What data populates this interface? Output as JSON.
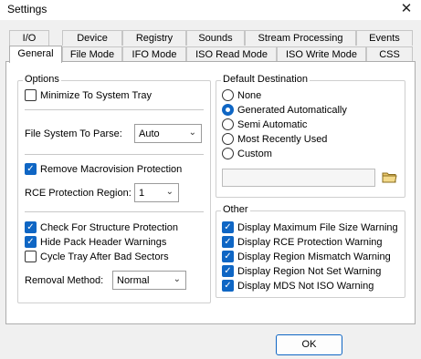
{
  "window": {
    "title": "Settings",
    "close_glyph": "✕"
  },
  "tabs_row1": [
    "I/O",
    "Device",
    "Registry",
    "Sounds",
    "Stream Processing",
    "Events"
  ],
  "tabs_row2": [
    "General",
    "File Mode",
    "IFO Mode",
    "ISO Read Mode",
    "ISO Write Mode",
    "CSS"
  ],
  "active_tab": "General",
  "options": {
    "title": "Options",
    "minimize_to_tray": {
      "label": "Minimize To System Tray",
      "checked": false
    },
    "fs_label": "File System To Parse:",
    "fs_value": "Auto",
    "remove_macrovision": {
      "label": "Remove Macrovision Protection",
      "checked": true
    },
    "rce_label": "RCE Protection Region:",
    "rce_value": "1",
    "check_structure": {
      "label": "Check For Structure Protection",
      "checked": true
    },
    "hide_pack_header": {
      "label": "Hide Pack Header Warnings",
      "checked": true
    },
    "cycle_tray": {
      "label": "Cycle Tray After Bad Sectors",
      "checked": false
    },
    "removal_label": "Removal Method:",
    "removal_value": "Normal"
  },
  "destination": {
    "title": "Default Destination",
    "radios": [
      {
        "label": "None",
        "checked": false
      },
      {
        "label": "Generated Automatically",
        "checked": true
      },
      {
        "label": "Semi Automatic",
        "checked": false
      },
      {
        "label": "Most Recently Used",
        "checked": false
      },
      {
        "label": "Custom",
        "checked": false
      }
    ],
    "custom_path": ""
  },
  "other": {
    "title": "Other",
    "items": [
      {
        "label": "Display Maximum File Size Warning",
        "checked": true
      },
      {
        "label": "Display RCE Protection Warning",
        "checked": true
      },
      {
        "label": "Display Region Mismatch Warning",
        "checked": true
      },
      {
        "label": "Display Region Not Set Warning",
        "checked": true
      },
      {
        "label": "Display MDS Not ISO Warning",
        "checked": true
      }
    ]
  },
  "buttons": {
    "ok": "OK"
  },
  "icons": {
    "check": "✓",
    "chevron": "⌄",
    "folder": "folder-icon",
    "close": "close-icon"
  },
  "colors": {
    "accent": "#0f66c4",
    "background": "#f0f0f0",
    "panel": "#ffffff"
  }
}
